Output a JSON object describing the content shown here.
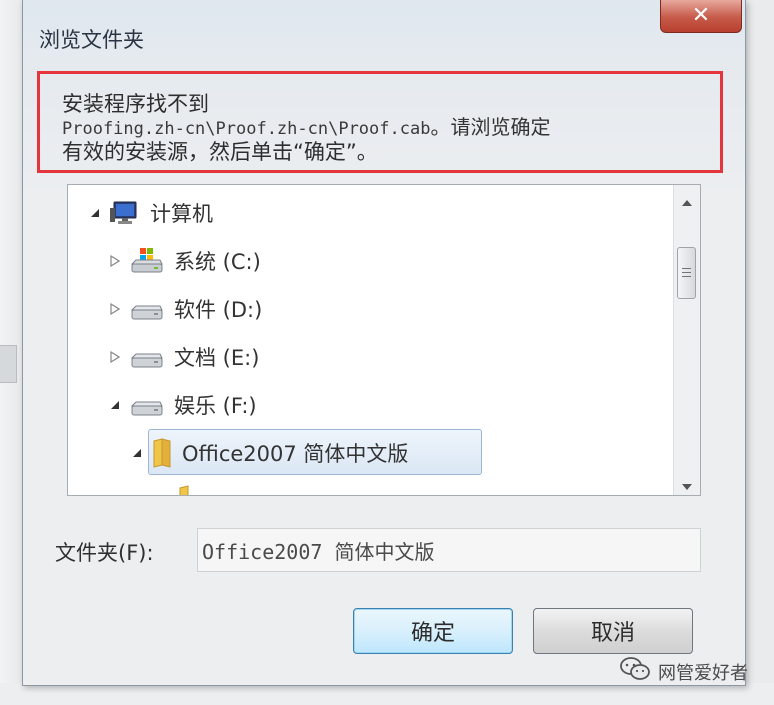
{
  "window": {
    "title": "浏览文件夹",
    "close_glyph": "✕"
  },
  "message": {
    "line1": "安装程序找不到",
    "path": "Proofing.zh-cn\\Proof.zh-cn\\Proof.cab",
    "line2_suffix": "。请浏览确定",
    "line3": "有效的安装源，然后单击“确定”。"
  },
  "tree": {
    "items": [
      {
        "label": "计算机",
        "icon": "computer-icon",
        "expanded": true
      },
      {
        "label": "系统 (C:)",
        "icon": "system-drive-icon",
        "expanded": false
      },
      {
        "label": "软件 (D:)",
        "icon": "drive-icon",
        "expanded": false
      },
      {
        "label": "文档 (E:)",
        "icon": "drive-icon",
        "expanded": false
      },
      {
        "label": "娱乐 (F:)",
        "icon": "drive-icon",
        "expanded": true
      },
      {
        "label": "Office2007 简体中文版",
        "icon": "folder-icon",
        "expanded": true,
        "selected": true
      }
    ]
  },
  "folder_field": {
    "label": "文件夹(F):",
    "value": "Office2007 简体中文版"
  },
  "buttons": {
    "ok": "确定",
    "cancel": "取消"
  },
  "watermark": {
    "text": "网管爱好者",
    "icon": "wechat-icon"
  },
  "colors": {
    "highlight_border": "#e5353c",
    "close_button": "#c65a49",
    "selection": "#dbe7f5"
  }
}
